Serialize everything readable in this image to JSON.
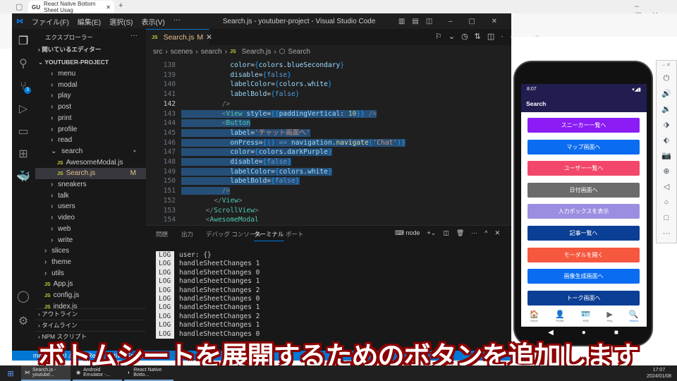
{
  "browser": {
    "tab_title": "React Native Bottom Sheet Usag",
    "tab_icon": "GU"
  },
  "vscode": {
    "title": "Search.js - youtuber-project - Visual Studio Code",
    "menus": [
      "ファイル(F)",
      "編集(E)",
      "選択(S)",
      "表示(V)",
      "···"
    ],
    "explorer_title": "エクスプローラー",
    "open_editors": "開いているエディター",
    "project": "YOUTUBER-PROJECT",
    "source_control_badge": "3",
    "tree": [
      {
        "label": "menu",
        "kind": "folder",
        "depth": 2
      },
      {
        "label": "modal",
        "kind": "folder",
        "depth": 2
      },
      {
        "label": "play",
        "kind": "folder",
        "depth": 2
      },
      {
        "label": "post",
        "kind": "folder",
        "depth": 2
      },
      {
        "label": "print",
        "kind": "folder",
        "depth": 2
      },
      {
        "label": "profile",
        "kind": "folder",
        "depth": 2
      },
      {
        "label": "read",
        "kind": "folder",
        "depth": 2
      },
      {
        "label": "search",
        "kind": "open",
        "depth": 2
      },
      {
        "label": "AwesomeModal.js",
        "kind": "js",
        "depth": 3
      },
      {
        "label": "Search.js",
        "kind": "js",
        "depth": 3,
        "badge": "M",
        "selected": true
      },
      {
        "label": "sneakers",
        "kind": "folder",
        "depth": 2
      },
      {
        "label": "talk",
        "kind": "folder",
        "depth": 2
      },
      {
        "label": "users",
        "kind": "folder",
        "depth": 2
      },
      {
        "label": "video",
        "kind": "folder",
        "depth": 2
      },
      {
        "label": "web",
        "kind": "folder",
        "depth": 2
      },
      {
        "label": "write",
        "kind": "folder",
        "depth": 2
      },
      {
        "label": "slices",
        "kind": "folder",
        "depth": 1
      },
      {
        "label": "theme",
        "kind": "folder",
        "depth": 1
      },
      {
        "label": "utils",
        "kind": "folder",
        "depth": 1
      },
      {
        "label": "App.js",
        "kind": "js",
        "depth": 1
      },
      {
        "label": "config.js",
        "kind": "js",
        "depth": 1
      },
      {
        "label": "index.js",
        "kind": "js",
        "depth": 1
      }
    ],
    "outline": "アウトライン",
    "timeline": "タイムライン",
    "npm": "NPM スクリプト",
    "tab": {
      "label": "Search.js",
      "badge": "M"
    },
    "breadcrumb": [
      "src",
      "scenes",
      "search",
      "Search.js",
      "Search"
    ],
    "code": [
      {
        "n": "138",
        "sel": false,
        "t": [
          [
            "            ",
            "txt"
          ],
          [
            "color",
            "attr"
          ],
          [
            "=",
            "txt"
          ],
          [
            "{",
            "br"
          ],
          [
            "colors",
            "attr"
          ],
          [
            ".",
            "txt"
          ],
          [
            "blueSecondary",
            "attr"
          ],
          [
            "}",
            "br"
          ]
        ]
      },
      {
        "n": "139",
        "sel": false,
        "t": [
          [
            "            ",
            "txt"
          ],
          [
            "disable",
            "attr"
          ],
          [
            "=",
            "txt"
          ],
          [
            "{",
            "br"
          ],
          [
            "false",
            "kw"
          ],
          [
            "}",
            "br"
          ]
        ]
      },
      {
        "n": "140",
        "sel": false,
        "t": [
          [
            "            ",
            "txt"
          ],
          [
            "labelColor",
            "attr"
          ],
          [
            "=",
            "txt"
          ],
          [
            "{",
            "br"
          ],
          [
            "colors",
            "attr"
          ],
          [
            ".",
            "txt"
          ],
          [
            "white",
            "attr"
          ],
          [
            "}",
            "br"
          ]
        ]
      },
      {
        "n": "141",
        "sel": false,
        "t": [
          [
            "            ",
            "txt"
          ],
          [
            "labelBold",
            "attr"
          ],
          [
            "=",
            "txt"
          ],
          [
            "{",
            "br"
          ],
          [
            "false",
            "kw"
          ],
          [
            "}",
            "br"
          ]
        ]
      },
      {
        "n": "142",
        "sel": false,
        "t": [
          [
            "          ",
            "txt"
          ],
          [
            "/>",
            "pun"
          ]
        ]
      },
      {
        "n": "143",
        "sel": true,
        "t": [
          [
            "          ",
            "txt"
          ],
          [
            "<",
            "pun"
          ],
          [
            "View",
            "tag"
          ],
          [
            " style",
            "attr"
          ],
          [
            "=",
            "txt"
          ],
          [
            "{{",
            "br"
          ],
          [
            "paddingVertical",
            "attr"
          ],
          [
            ": ",
            "txt"
          ],
          [
            "10",
            "num"
          ],
          [
            "}}",
            "br"
          ],
          [
            " />",
            "pun"
          ]
        ]
      },
      {
        "n": "144",
        "sel": true,
        "t": [
          [
            "          ",
            "txt"
          ],
          [
            "<",
            "pun"
          ],
          [
            "Button",
            "tag"
          ]
        ]
      },
      {
        "n": "145",
        "sel": true,
        "t": [
          [
            "            ",
            "txt"
          ],
          [
            "label",
            "attr"
          ],
          [
            "=",
            "txt"
          ],
          [
            "'チャット画面へ'",
            "str"
          ]
        ]
      },
      {
        "n": "146",
        "sel": true,
        "t": [
          [
            "            ",
            "txt"
          ],
          [
            "onPress",
            "attr"
          ],
          [
            "=",
            "txt"
          ],
          [
            "{",
            "br"
          ],
          [
            "() ",
            "br"
          ],
          [
            "=>",
            "kw"
          ],
          [
            " navigation",
            "attr"
          ],
          [
            ".",
            "txt"
          ],
          [
            "navigate",
            "fn"
          ],
          [
            "(",
            "br"
          ],
          [
            "'Chat'",
            "str"
          ],
          [
            ")",
            "br"
          ],
          [
            "}",
            "br"
          ]
        ]
      },
      {
        "n": "147",
        "sel": true,
        "t": [
          [
            "            ",
            "txt"
          ],
          [
            "color",
            "attr"
          ],
          [
            "=",
            "txt"
          ],
          [
            "{",
            "br"
          ],
          [
            "colors",
            "attr"
          ],
          [
            ".",
            "txt"
          ],
          [
            "darkPurple",
            "attr"
          ],
          [
            "}",
            "br"
          ]
        ]
      },
      {
        "n": "148",
        "sel": true,
        "t": [
          [
            "            ",
            "txt"
          ],
          [
            "disable",
            "attr"
          ],
          [
            "=",
            "txt"
          ],
          [
            "{",
            "br"
          ],
          [
            "false",
            "kw"
          ],
          [
            "}",
            "br"
          ]
        ]
      },
      {
        "n": "149",
        "sel": true,
        "t": [
          [
            "            ",
            "txt"
          ],
          [
            "labelColor",
            "attr"
          ],
          [
            "=",
            "txt"
          ],
          [
            "{",
            "br"
          ],
          [
            "colors",
            "attr"
          ],
          [
            ".",
            "txt"
          ],
          [
            "white",
            "attr"
          ],
          [
            "}",
            "br"
          ]
        ]
      },
      {
        "n": "150",
        "sel": true,
        "t": [
          [
            "            ",
            "txt"
          ],
          [
            "labelBold",
            "attr"
          ],
          [
            "=",
            "txt"
          ],
          [
            "{",
            "br"
          ],
          [
            "false",
            "kw"
          ],
          [
            "}",
            "br"
          ]
        ]
      },
      {
        "n": "151",
        "sel": true,
        "t": [
          [
            "          ",
            "txt"
          ],
          [
            "/>",
            "pun"
          ]
        ]
      },
      {
        "n": "152",
        "sel": false,
        "t": [
          [
            "        ",
            "txt"
          ],
          [
            "</",
            "pun"
          ],
          [
            "View",
            "tag"
          ],
          [
            ">",
            "pun"
          ]
        ]
      },
      {
        "n": "153",
        "sel": false,
        "t": [
          [
            "      ",
            "txt"
          ],
          [
            "</",
            "pun"
          ],
          [
            "ScrollView",
            "tag"
          ],
          [
            ">",
            "pun"
          ]
        ]
      },
      {
        "n": "154",
        "sel": false,
        "t": [
          [
            "      ",
            "txt"
          ],
          [
            "<",
            "pun"
          ],
          [
            "AwesomeModal",
            "tag"
          ]
        ]
      }
    ],
    "panel_tabs": [
      "問題",
      "出力",
      "デバッグ コンソール",
      "ターミナル",
      "ポート"
    ],
    "terminal_name": "node",
    "logs": [
      "user: {}",
      "handleSheetChanges 1",
      "handleSheetChanges 0",
      "handleSheetChanges 1",
      "handleSheetChanges 2",
      "handleSheetChanges 0",
      "handleSheetChanges 1",
      "handleSheetChanges 2",
      "handleSheetChanges 1",
      "handleSheetChanges 0"
    ],
    "log_badge": "LOG",
    "status_text": "main  ⟳  ⊗ 0 ⚠ 0   ▷ React Native   Go Live"
  },
  "phone": {
    "time": "8:07",
    "app_title": "Search",
    "buttons": [
      {
        "label": "スニーカー一覧へ",
        "color": "#8c1cf5"
      },
      {
        "label": "マップ画面へ",
        "color": "#0a6cf0"
      },
      {
        "label": "ユーザー一覧へ",
        "color": "#f2476a"
      },
      {
        "label": "日付画面へ",
        "color": "#6b6b6b"
      },
      {
        "label": "入力ボックスを表示",
        "color": "#9b8ee0"
      },
      {
        "label": "記事一覧へ",
        "color": "#0b3f95"
      },
      {
        "label": "モーダルを開く",
        "color": "#f5573f"
      },
      {
        "label": "画像生成画面へ",
        "color": "#0a6cf0"
      },
      {
        "label": "トーク画面へ",
        "color": "#0b3f95"
      }
    ],
    "nav": [
      {
        "label": "Home",
        "icon": "🏠"
      },
      {
        "label": "Profile",
        "icon": "👤"
      },
      {
        "label": "R/W",
        "icon": "🪪"
      },
      {
        "label": "Play",
        "icon": "▶"
      },
      {
        "label": "Search",
        "icon": "🔍",
        "active": true
      }
    ]
  },
  "subtitle": "ボトムシートを展開するためのボタンを追加します",
  "taskbar": {
    "items": [
      "Search.js - youtube...",
      "Android Emulator -...",
      "React Native Botto..."
    ],
    "time": "17:07",
    "date": "2024/01/08"
  }
}
